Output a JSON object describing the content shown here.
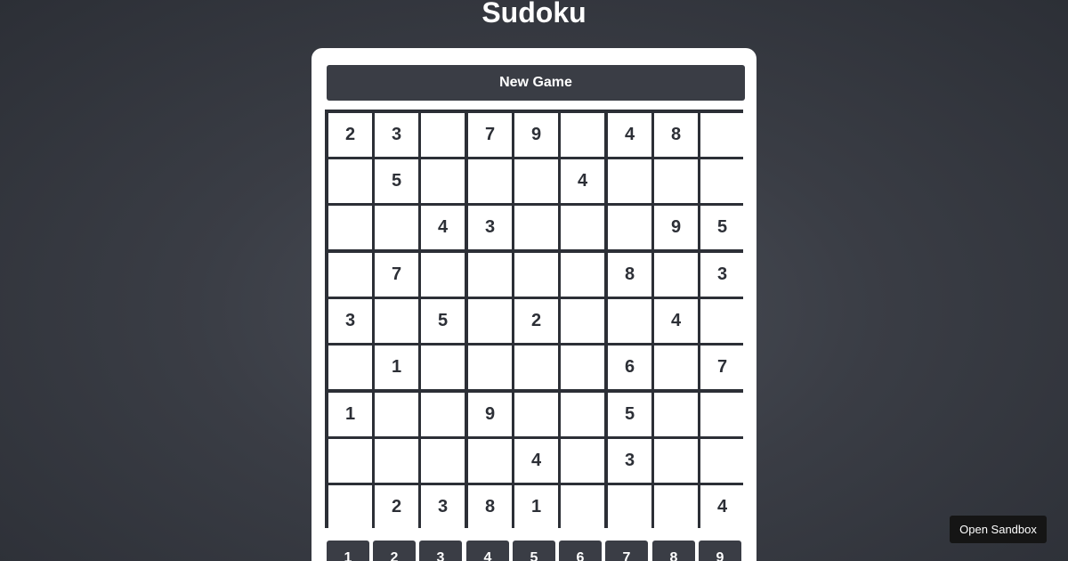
{
  "title": "Sudoku",
  "new_game_label": "New Game",
  "open_sandbox_label": "Open Sandbox",
  "board": [
    [
      "2",
      "3",
      "",
      "7",
      "9",
      "",
      "4",
      "8",
      ""
    ],
    [
      "",
      "5",
      "",
      "",
      "",
      "4",
      "",
      "",
      ""
    ],
    [
      "",
      "",
      "4",
      "3",
      "",
      "",
      "",
      "9",
      "5"
    ],
    [
      "",
      "7",
      "",
      "",
      "",
      "",
      "8",
      "",
      "3"
    ],
    [
      "3",
      "",
      "5",
      "",
      "2",
      "",
      "",
      "4",
      ""
    ],
    [
      "",
      "1",
      "",
      "",
      "",
      "",
      "6",
      "",
      "7"
    ],
    [
      "1",
      "",
      "",
      "9",
      "",
      "",
      "5",
      "",
      ""
    ],
    [
      "",
      "",
      "",
      "",
      "4",
      "",
      "3",
      "",
      ""
    ],
    [
      "",
      "2",
      "3",
      "8",
      "1",
      "",
      "",
      "",
      "4"
    ]
  ],
  "numpad": [
    "1",
    "2",
    "3",
    "4",
    "5",
    "6",
    "7",
    "8",
    "9"
  ]
}
